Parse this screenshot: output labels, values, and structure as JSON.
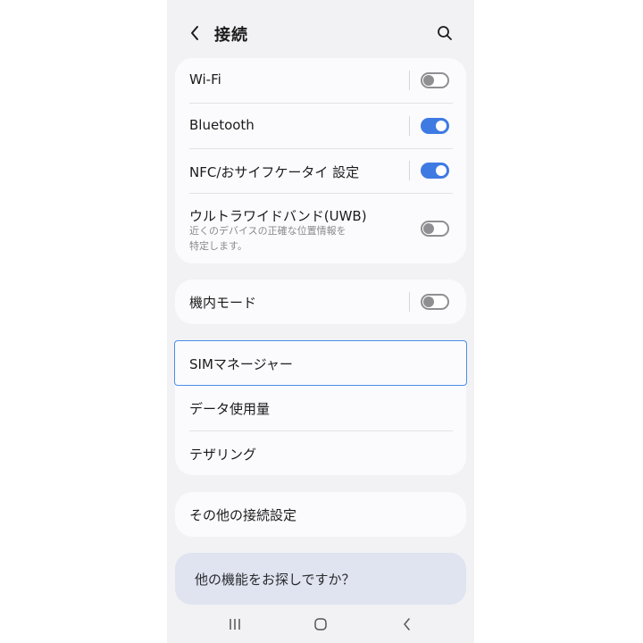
{
  "header": {
    "title": "接続"
  },
  "group1": {
    "wifi": {
      "label": "Wi-Fi",
      "toggle": "off"
    },
    "bluetooth": {
      "label": "Bluetooth",
      "toggle": "on"
    },
    "nfc": {
      "label": "NFC/おサイフケータイ 設定",
      "toggle": "on"
    },
    "uwb": {
      "label": "ウルトラワイドバンド(UWB)",
      "sub_line1": "近くのデバイスの正確な位置情報を",
      "sub_line2": "特定します。",
      "toggle": "off"
    }
  },
  "group2": {
    "airplane": {
      "label": "機内モード",
      "toggle": "off"
    }
  },
  "group3": {
    "items": [
      {
        "label": "SIMマネージャー"
      },
      {
        "label": "データ使用量"
      },
      {
        "label": "テザリング"
      }
    ]
  },
  "group4": {
    "more": {
      "label": "その他の接続設定"
    }
  },
  "banner": {
    "text": "他の機能をお探しですか？"
  },
  "colors": {
    "accent": "#3f7ae3",
    "focus": "#4a8ee8",
    "background": "#f2f2f4",
    "card": "#fbfbfd",
    "banner": "#dfe4f0"
  },
  "icons": {
    "back": "chevron-left-icon",
    "search": "search-icon",
    "nav_recents": "recents-icon",
    "nav_home": "home-icon",
    "nav_back": "back-icon"
  }
}
